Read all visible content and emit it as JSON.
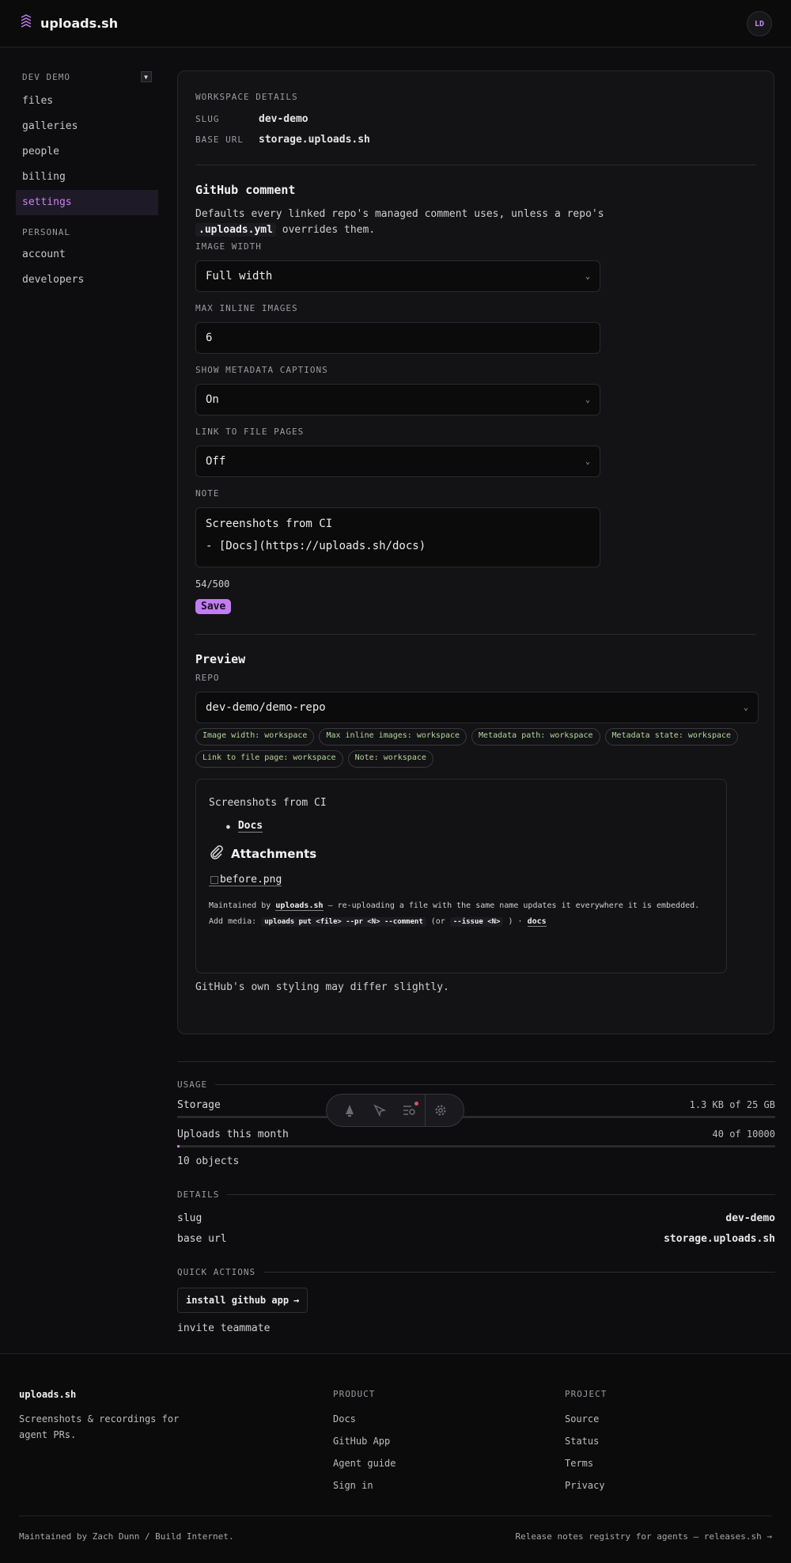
{
  "app": {
    "name": "uploads.sh",
    "avatar_initials": "LD"
  },
  "sidebar": {
    "workspace_label": "DEV DEMO",
    "items": [
      {
        "label": "files"
      },
      {
        "label": "galleries"
      },
      {
        "label": "people"
      },
      {
        "label": "billing"
      },
      {
        "label": "settings"
      }
    ],
    "personal_label": "PERSONAL",
    "personal_items": [
      {
        "label": "account"
      },
      {
        "label": "developers"
      }
    ]
  },
  "workspace": {
    "title": "WORKSPACE DETAILS",
    "slug_label": "SLUG",
    "slug": "dev-demo",
    "base_url_label": "BASE URL",
    "base_url": "storage.uploads.sh"
  },
  "github_comment": {
    "title": "GitHub comment",
    "desc_part1": "Defaults every linked repo's managed comment uses, unless a repo's",
    "desc_code": ".uploads.yml",
    "desc_part2": "overrides them.",
    "image_width_label": "IMAGE WIDTH",
    "image_width_value": "Full width",
    "max_inline_label": "MAX INLINE IMAGES",
    "max_inline_value": "6",
    "show_captions_label": "SHOW METADATA CAPTIONS",
    "show_captions_value": "On",
    "link_pages_label": "LINK TO FILE PAGES",
    "link_pages_value": "Off",
    "note_label": "NOTE",
    "note_line1": "Screenshots from CI",
    "note_line2": "- [Docs](https://uploads.sh/docs)",
    "char_count": "54/500",
    "save_label": "Save"
  },
  "preview": {
    "title": "Preview",
    "repo_label": "REPO",
    "repo_value": "dev-demo/demo-repo",
    "chips": [
      "Image width: workspace",
      "Max inline images: workspace",
      "Metadata path: workspace",
      "Metadata state: workspace",
      "Link to file page: workspace",
      "Note: workspace"
    ],
    "rendered_intro": "Screenshots from CI",
    "rendered_bullet": "Docs",
    "attachments_heading": "Attachments",
    "image_alt": "before.png",
    "maintained_prefix": "Maintained by",
    "maintained_link": "uploads.sh",
    "maintained_suffix": "— re-uploading a file with the same name updates it everywhere it is embedded.",
    "add_media_prefix": "Add media:",
    "add_media_cmd": "uploads put <file> --pr <N> --comment",
    "add_media_or": "(or",
    "add_media_cmd2": "--issue <N>",
    "add_media_close": ") ·",
    "add_media_docs": "docs",
    "note": "GitHub's own styling may differ slightly."
  },
  "usage": {
    "title": "USAGE",
    "storage_label": "Storage",
    "storage_value": "1.3 KB of 25 GB",
    "storage_fraction": 5e-08,
    "uploads_label": "Uploads this month",
    "uploads_value": "40 of 10000",
    "uploads_fraction": 0.004,
    "objects": "10 objects"
  },
  "details": {
    "title": "DETAILS",
    "slug_label": "slug",
    "slug": "dev-demo",
    "base_url_label": "base url",
    "base_url": "storage.uploads.sh"
  },
  "quick_actions": {
    "title": "QUICK ACTIONS",
    "install_label": "install github app",
    "invite_label": "invite teammate"
  },
  "footer": {
    "brand": "uploads.sh",
    "tagline_line1": "Screenshots & recordings for",
    "tagline_line2": "agent PRs.",
    "product_title": "PRODUCT",
    "product_links": [
      "Docs",
      "GitHub App",
      "Agent guide",
      "Sign in"
    ],
    "project_title": "PROJECT",
    "project_links": [
      "Source",
      "Status",
      "Terms",
      "Privacy"
    ],
    "maintained": "Maintained by Zach Dunn / Build Internet.",
    "release_notes": "Release notes registry for agents — releases.sh →"
  },
  "colors": {
    "accent": "#c07ef0",
    "chip_text": "#b7d79a",
    "background": "#0d0d0f"
  },
  "icons": [
    "logo-icon",
    "chevron-down-icon",
    "paperclip-icon",
    "arrow-right-icon",
    "bell-icon",
    "cursor-icon",
    "search-list-icon",
    "gear-icon"
  ]
}
